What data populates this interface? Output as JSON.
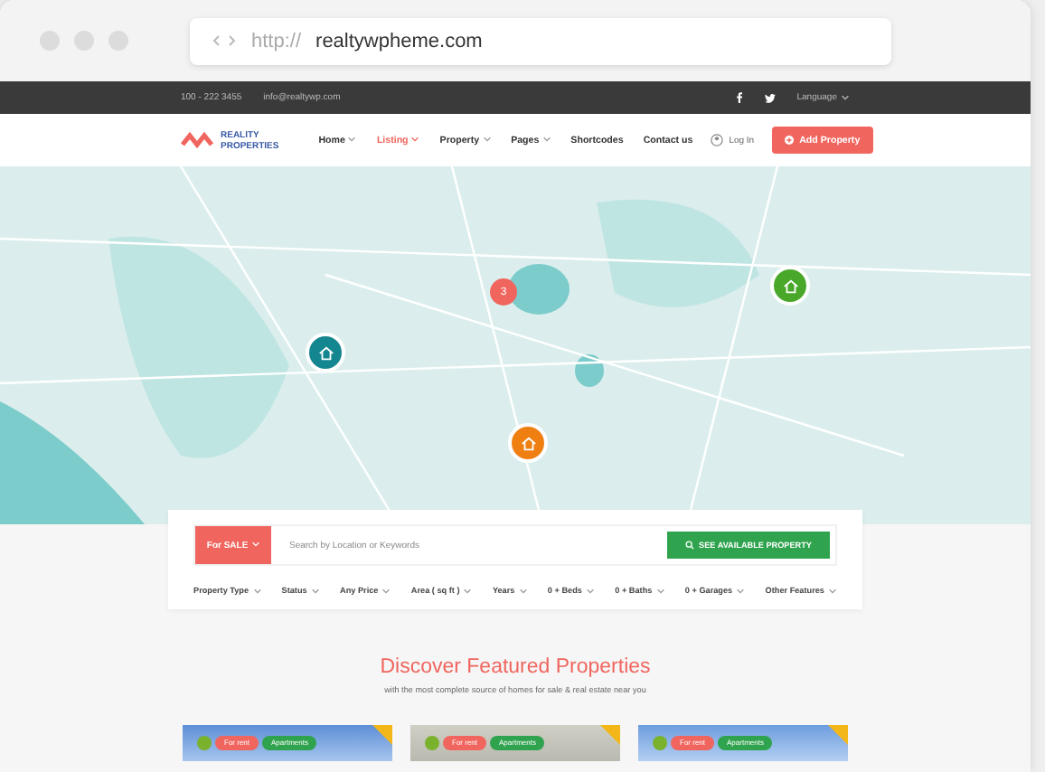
{
  "browser": {
    "protocol": "http://",
    "domain": "realtywpheme.com"
  },
  "topbar": {
    "phone": "100 - 222 3455",
    "email": "info@realtywp.com",
    "language": "Language"
  },
  "header": {
    "logo_line1": "REALITY",
    "logo_line2": "PROPERTIES",
    "nav": [
      {
        "label": "Home",
        "selected": false,
        "dropdown": true
      },
      {
        "label": "Listing",
        "selected": true,
        "dropdown": true
      },
      {
        "label": "Property",
        "selected": false,
        "dropdown": true
      },
      {
        "label": "Pages",
        "selected": false,
        "dropdown": true
      },
      {
        "label": "Shortcodes",
        "selected": false,
        "dropdown": false
      },
      {
        "label": "Contact us",
        "selected": false,
        "dropdown": false
      }
    ],
    "login": "Log In",
    "add_button": "Add Property"
  },
  "map": {
    "cluster": {
      "count": "3"
    },
    "markers": [
      {
        "color": "#13868f"
      },
      {
        "color": "#49a82a"
      },
      {
        "color": "#f07f12"
      }
    ]
  },
  "search": {
    "type": "For SALE",
    "placeholder": "Search by Location or Keywords",
    "button": "SEE AVAILABLE PROPERTY",
    "filters": [
      "Property Type",
      "Status",
      "Any Price",
      "Area ( sq ft )",
      "Years",
      "0 + Beds",
      "0 + Baths",
      "0 + Garages",
      "Other Features"
    ]
  },
  "featured": {
    "title": "Discover Featured Properties",
    "subtitle": "with the most complete source of homes for sale & real estate near you",
    "cards": [
      {
        "status": "For rent",
        "category": "Apartments"
      },
      {
        "status": "For rent",
        "category": "Apartments"
      },
      {
        "status": "For rent",
        "category": "Apartments"
      }
    ]
  }
}
